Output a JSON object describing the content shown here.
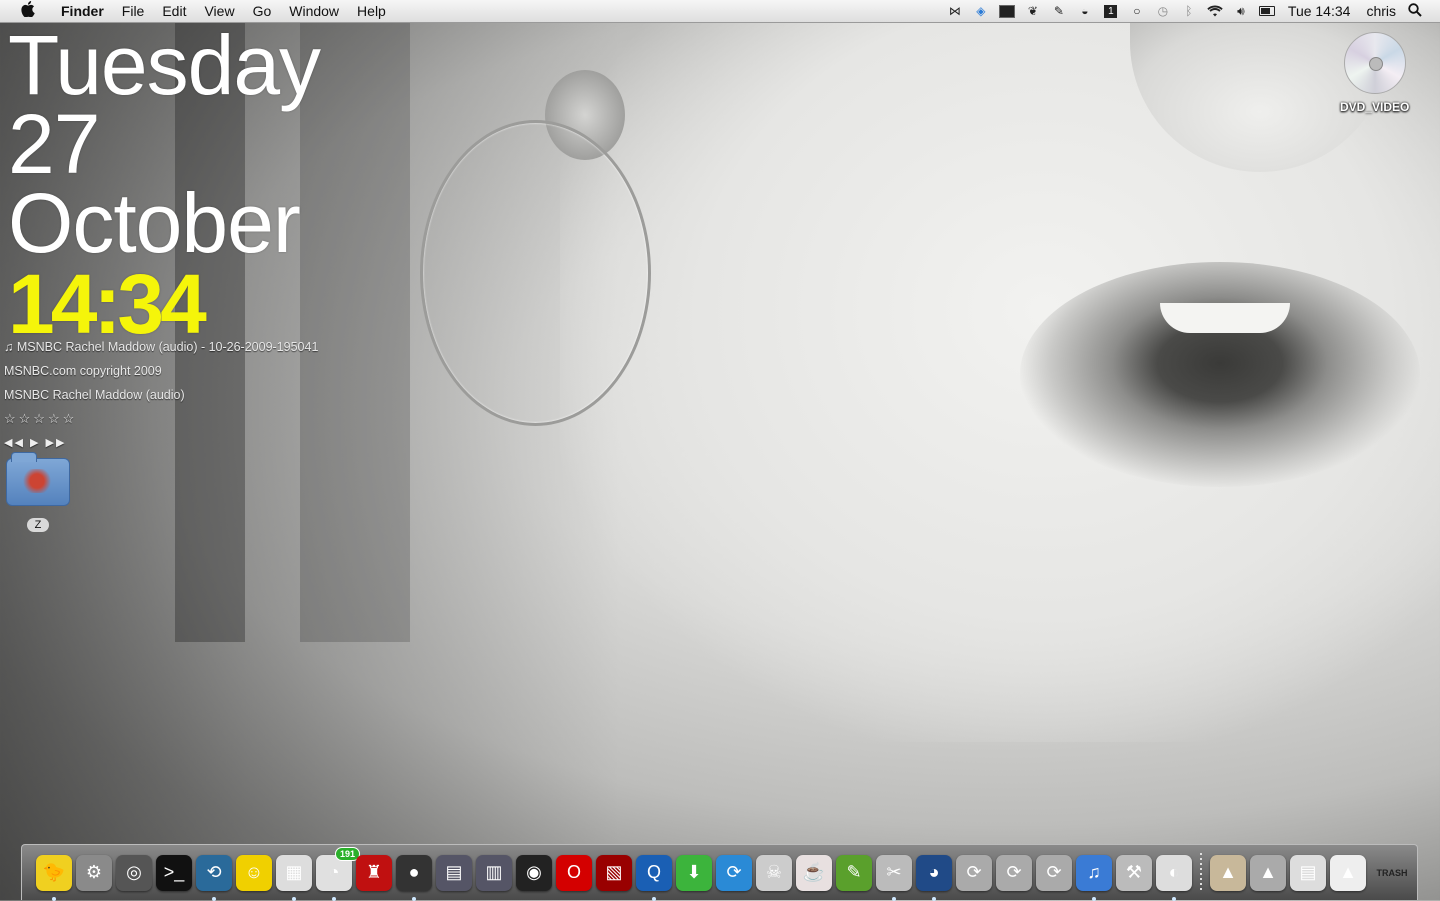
{
  "menubar": {
    "apple_icon": "apple-logo-icon",
    "app_name": "Finder",
    "menus": [
      "File",
      "Edit",
      "View",
      "Go",
      "Window",
      "Help"
    ],
    "status_icons": [
      "butterfly-icon",
      "dropbox-icon",
      "terminal-icon",
      "paw-icon",
      "evernote-icon",
      "drive-icon",
      "one-icon",
      "chat-bubble-icon",
      "time-machine-icon",
      "bluetooth-icon",
      "wifi-icon",
      "volume-icon",
      "battery-icon"
    ],
    "clock": "Tue 14:34",
    "user": "chris",
    "spotlight_icon": "magnifier-icon"
  },
  "date_widget": {
    "weekday": "Tuesday",
    "day": "27",
    "month": "October",
    "time": "14:34"
  },
  "now_playing": {
    "track": "♫ MSNBC Rachel Maddow (audio) - 10-26-2009-195041",
    "artist": "MSNBC.com copyright 2009",
    "album": "MSNBC Rachel Maddow (audio)",
    "rating_stars": "☆☆☆☆☆",
    "rating": 0,
    "controls": "◀◀ ▶ ▶▶"
  },
  "desktop_icons": {
    "folder_label": "Z",
    "dvd_label": "DVD_VIDEO"
  },
  "dock": {
    "items": [
      {
        "name": "tweety-icon",
        "glyph": "🐤",
        "color": "#f0d020",
        "running": true
      },
      {
        "name": "system-preferences-icon",
        "glyph": "⚙",
        "color": "#8a8a8a",
        "running": false
      },
      {
        "name": "istat-gauge-icon",
        "glyph": "◎",
        "color": "#555",
        "running": false
      },
      {
        "name": "terminal-icon",
        "glyph": ">_",
        "color": "#111",
        "running": false
      },
      {
        "name": "time-machine-icon",
        "glyph": "⟲",
        "color": "#2a6a9a",
        "running": true
      },
      {
        "name": "adium-smiley-icon",
        "glyph": "☺",
        "color": "#f0d000",
        "running": false
      },
      {
        "name": "preview-icon",
        "glyph": "▦",
        "color": "#ddd",
        "running": true
      },
      {
        "name": "rss-reader-icon",
        "glyph": "◔",
        "color": "#e0e0e0",
        "running": true,
        "badge": "191"
      },
      {
        "name": "red-chair-icon",
        "glyph": "♜",
        "color": "#c01010",
        "running": false
      },
      {
        "name": "video-chat-icon",
        "glyph": "●",
        "color": "#333",
        "running": true
      },
      {
        "name": "photo-app-icon",
        "glyph": "▤",
        "color": "#556",
        "running": false
      },
      {
        "name": "dashboard-icon",
        "glyph": "▥",
        "color": "#556",
        "running": false
      },
      {
        "name": "speaker-icon",
        "glyph": "◉",
        "color": "#222",
        "running": false
      },
      {
        "name": "opera-icon",
        "glyph": "O",
        "color": "#d40000",
        "running": false
      },
      {
        "name": "photo-booth-icon",
        "glyph": "▧",
        "color": "#900",
        "running": false
      },
      {
        "name": "quicktime-icon",
        "glyph": "Q",
        "color": "#1a5fb4",
        "running": true
      },
      {
        "name": "download-icon",
        "glyph": "⬇",
        "color": "#3cb43c",
        "running": false
      },
      {
        "name": "sync-icon",
        "glyph": "⟳",
        "color": "#2a8ad6",
        "running": false
      },
      {
        "name": "kaws-figure-icon",
        "glyph": "☠",
        "color": "#ccc",
        "running": false
      },
      {
        "name": "teacup-icon",
        "glyph": "☕",
        "color": "#e8e0e0",
        "running": false
      },
      {
        "name": "evernote-icon",
        "glyph": "✎",
        "color": "#5aa02c",
        "running": false
      },
      {
        "name": "utility-tools-icon",
        "glyph": "✂",
        "color": "#bbb",
        "running": true
      },
      {
        "name": "firefox-icon",
        "glyph": "◕",
        "color": "#204a87",
        "running": true
      },
      {
        "name": "sync-arrows-1-icon",
        "glyph": "⟳",
        "color": "#aaa",
        "running": false
      },
      {
        "name": "sync-arrows-2-icon",
        "glyph": "⟳",
        "color": "#aaa",
        "running": false
      },
      {
        "name": "sync-arrows-3-icon",
        "glyph": "⟳",
        "color": "#aaa",
        "running": false
      },
      {
        "name": "itunes-icon",
        "glyph": "♫",
        "color": "#3a7bd5",
        "running": true
      },
      {
        "name": "maintenance-robot-icon",
        "glyph": "⚒",
        "color": "#bbb",
        "running": false
      },
      {
        "name": "dvd-player-icon",
        "glyph": "◐",
        "color": "#ddd",
        "running": true
      },
      {
        "name": "applications-stack-icon",
        "glyph": "▲",
        "color": "#c8b89a",
        "running": false
      },
      {
        "name": "utilities-stack-icon",
        "glyph": "▲",
        "color": "#aaa",
        "running": false
      },
      {
        "name": "documents-stack-icon",
        "glyph": "▤",
        "color": "#ddd",
        "running": false
      },
      {
        "name": "downloads-stack-icon",
        "glyph": "▲",
        "color": "#eee",
        "running": false
      }
    ],
    "trash_label": "TRASH"
  },
  "colors": {
    "time_yellow": "#f5f50a",
    "date_white": "#ffffff"
  }
}
